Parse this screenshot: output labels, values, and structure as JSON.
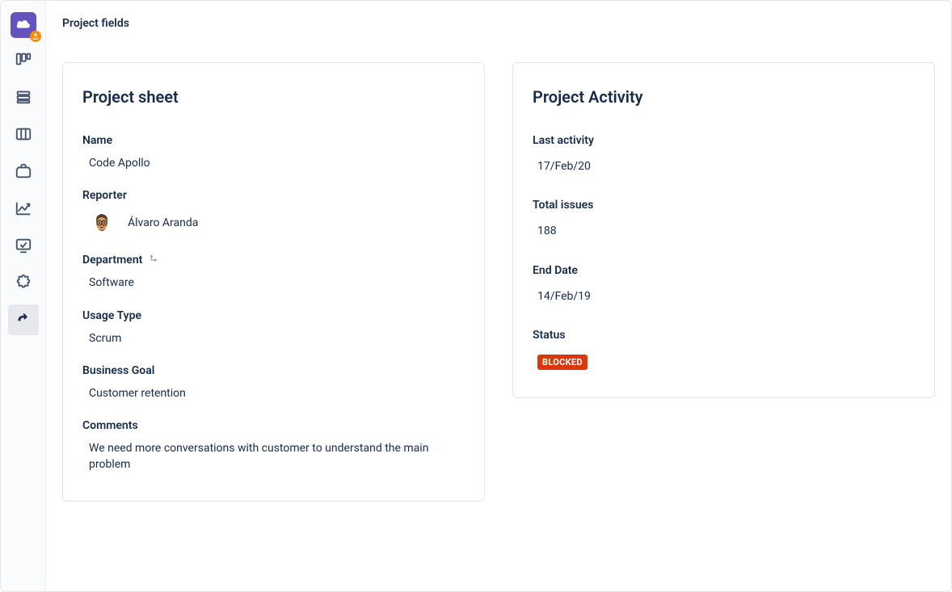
{
  "header": {
    "title": "Project fields"
  },
  "cards": {
    "sheet": {
      "title": "Project sheet",
      "fields": {
        "name_label": "Name",
        "name_value": "Code Apollo",
        "reporter_label": "Reporter",
        "reporter_value": "Álvaro Aranda",
        "department_label": "Department",
        "department_value": "Software",
        "usage_type_label": "Usage Type",
        "usage_type_value": "Scrum",
        "business_goal_label": "Business Goal",
        "business_goal_value": "Customer retention",
        "comments_label": "Comments",
        "comments_value": "We need more conversations with customer to understand the main problem"
      }
    },
    "activity": {
      "title": "Project Activity",
      "fields": {
        "last_activity_label": "Last activity",
        "last_activity_value": "17/Feb/20",
        "total_issues_label": "Total issues",
        "total_issues_value": "188",
        "end_date_label": "End Date",
        "end_date_value": "14/Feb/19",
        "status_label": "Status",
        "status_value": "BLOCKED"
      }
    }
  },
  "sidebar": {
    "items": [
      "logo",
      "board",
      "backlog",
      "columns",
      "package",
      "reports",
      "monitor",
      "addon",
      "integration"
    ]
  }
}
